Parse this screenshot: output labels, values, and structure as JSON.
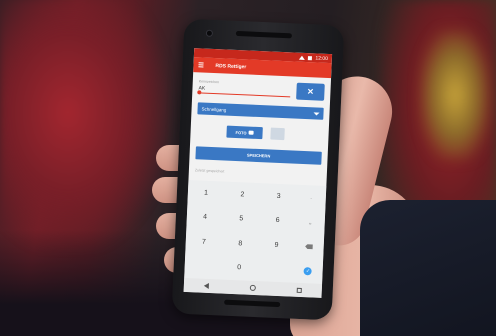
{
  "app": {
    "title": "RDS Rettiger"
  },
  "form": {
    "field_label": "Kennzeichen",
    "field_value": "AK",
    "select_value": "Schnellgang",
    "foto_label": "FOTO",
    "save_label": "SPEICHERN",
    "hint_text": "Zuletzt gespeichert"
  },
  "keypad": {
    "keys": [
      "1",
      "2",
      "3",
      "-",
      "4",
      "5",
      "6",
      "␣",
      "7",
      "8",
      "9",
      "⌫",
      "",
      "0",
      "",
      "✓"
    ]
  },
  "status": {
    "time": "12:00"
  },
  "colors": {
    "appbar": "#e33a27",
    "statusbar": "#c6281c",
    "accent_blue": "#3a78c4"
  }
}
